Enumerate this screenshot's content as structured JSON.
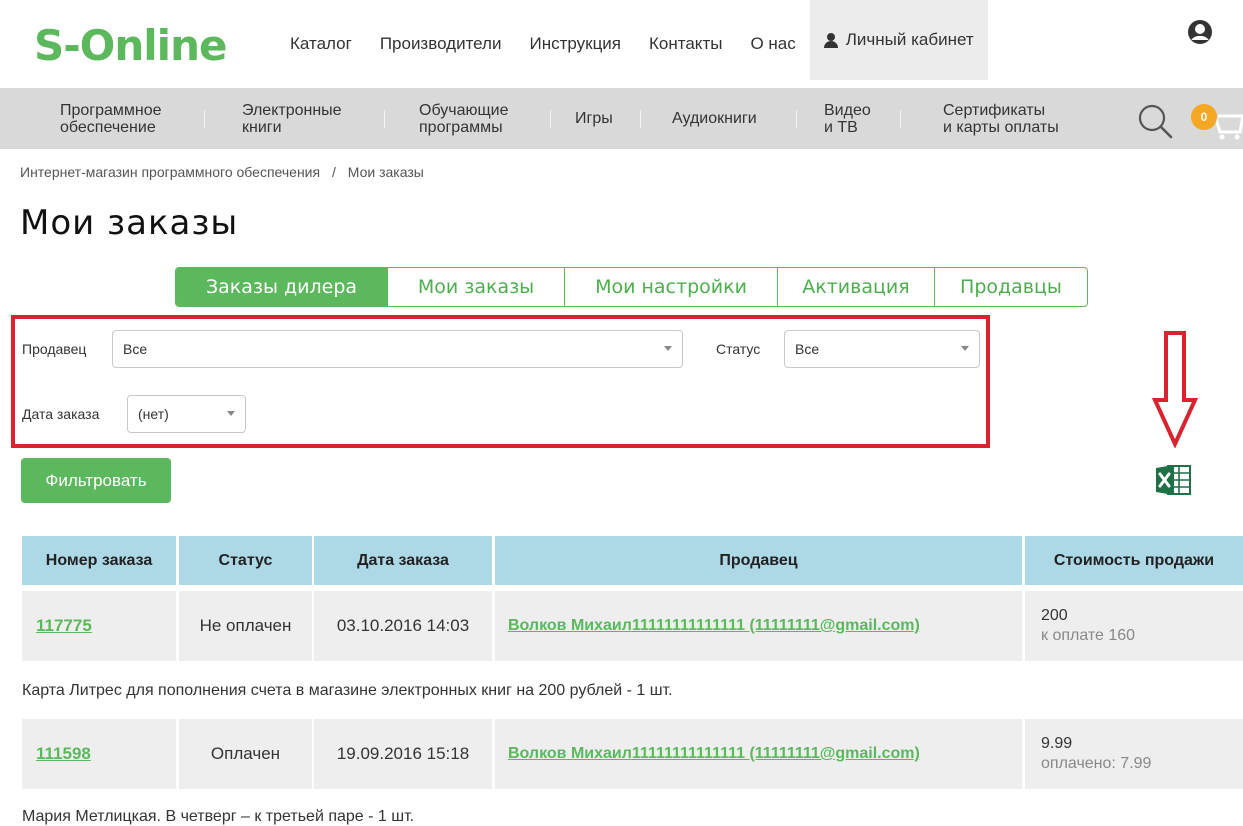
{
  "brand": {
    "logo": "S-Online",
    "accent_color": "#5cb85c",
    "highlight_color": "#d9232e"
  },
  "topnav": {
    "items": [
      "Каталог",
      "Производители",
      "Инструкция",
      "Контакты",
      "О нас"
    ],
    "cabinet_label": "Личный кабинет",
    "account_icon": "user-circle-icon"
  },
  "categories": {
    "items": [
      {
        "line1": "Программное",
        "line2": "обеспечение"
      },
      {
        "line1": "Электронные",
        "line2": "книги"
      },
      {
        "line1": "Обучающие",
        "line2": "программы"
      },
      {
        "line1": "Игры",
        "line2": ""
      },
      {
        "line1": "Аудиокниги",
        "line2": ""
      },
      {
        "line1": "Видео",
        "line2": "и ТВ"
      },
      {
        "line1": "Сертификаты",
        "line2": "и карты оплаты"
      }
    ],
    "cart_count": "0"
  },
  "breadcrumb": {
    "root": "Интернет-магазин программного обеспечения",
    "separator": "/",
    "current": "Мои заказы"
  },
  "page_title": "Мои заказы",
  "tabs": [
    "Заказы дилера",
    "Мои заказы",
    "Мои настройки",
    "Активация",
    "Продавцы"
  ],
  "filters": {
    "seller_label": "Продавец",
    "seller_value": "Все",
    "status_label": "Статус",
    "status_value": "Все",
    "date_label": "Дата заказа",
    "date_value": "(нет)",
    "submit_label": "Фильтровать"
  },
  "table": {
    "columns": [
      "Номер заказа",
      "Статус",
      "Дата заказа",
      "Продавец",
      "Стоимость продажи"
    ],
    "rows": [
      {
        "order": "117775",
        "status": "Не оплачен",
        "date": "03.10.2016 14:03",
        "seller": "Волков Михаил11111111111111 (11111111@gmail.com)",
        "price": "200",
        "price_note": "к оплате 160",
        "description": "Карта Литрес для пополнения счета в магазине электронных книг на 200 рублей - 1 шт."
      },
      {
        "order": "111598",
        "status": "Оплачен",
        "date": "19.09.2016 15:18",
        "seller": "Волков Михаил11111111111111 (11111111@gmail.com)",
        "price": "9.99",
        "price_note": "оплачено: 7.99",
        "description": "Мария Метлицкая. В четверг – к третьей паре - 1 шт."
      }
    ]
  }
}
